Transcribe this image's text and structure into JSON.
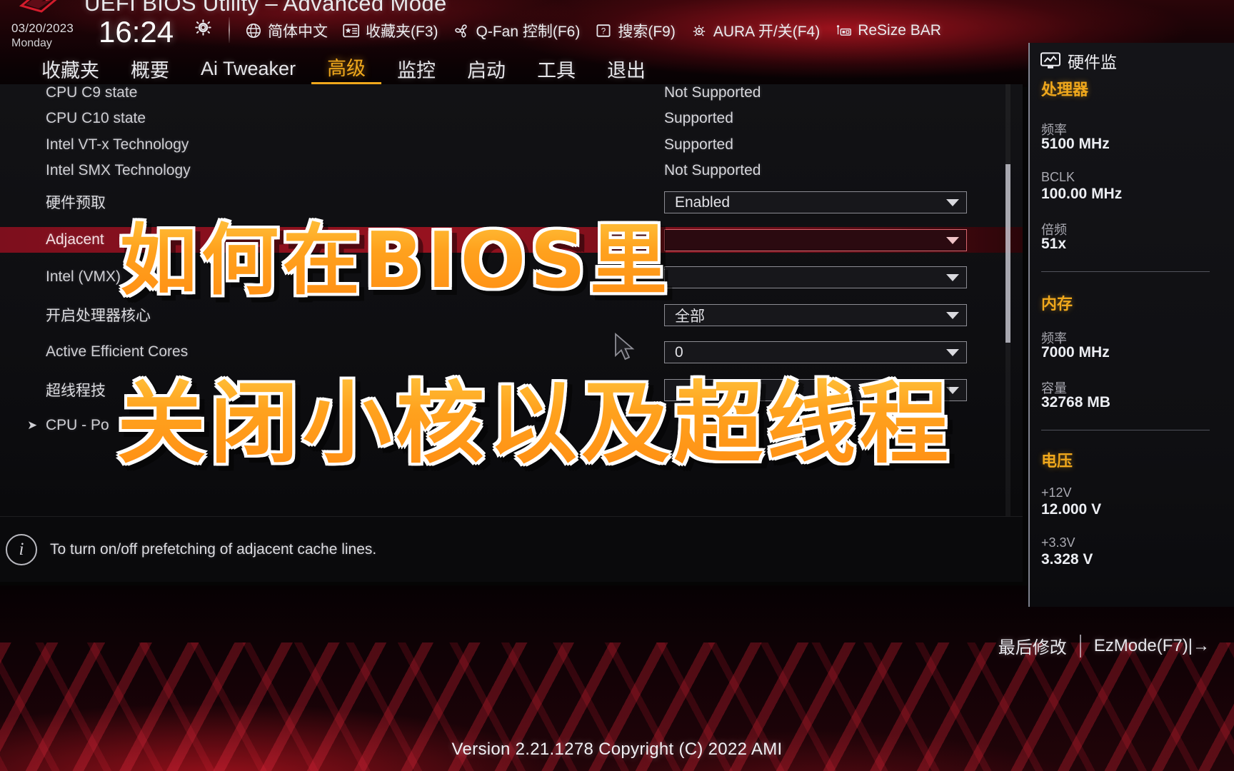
{
  "window": {
    "title": "UEFI BIOS Utility – Advanced Mode",
    "brand_logo": "rog-logo"
  },
  "statusbar": {
    "date": "03/20/2023",
    "weekday": "Monday",
    "time": "16:24",
    "settings_icon": "gear-icon",
    "tools": [
      {
        "icon": "globe-icon",
        "label": "简体中文"
      },
      {
        "icon": "star-icon",
        "label": "收藏夹(F3)"
      },
      {
        "icon": "fan-icon",
        "label": "Q-Fan 控制(F6)"
      },
      {
        "icon": "help-icon",
        "label": "搜索(F9)"
      },
      {
        "icon": "aura-icon",
        "label": "AURA 开/关(F4)"
      },
      {
        "icon": "resizebar-icon",
        "label": "ReSize BAR"
      }
    ]
  },
  "nav": {
    "tabs": [
      {
        "label": "收藏夹",
        "active": false
      },
      {
        "label": "概要",
        "active": false
      },
      {
        "label": "Ai Tweaker",
        "active": false
      },
      {
        "label": "高级",
        "active": true
      },
      {
        "label": "监控",
        "active": false
      },
      {
        "label": "启动",
        "active": false
      },
      {
        "label": "工具",
        "active": false
      },
      {
        "label": "退出",
        "active": false
      }
    ]
  },
  "settings": {
    "rows": [
      {
        "label": "CPU C9 state",
        "value": "Not Supported",
        "type": "text",
        "selected": false,
        "submenu": false
      },
      {
        "label": "CPU C10 state",
        "value": "Supported",
        "type": "text",
        "selected": false,
        "submenu": false
      },
      {
        "label": "Intel VT-x Technology",
        "value": "Supported",
        "type": "text",
        "selected": false,
        "submenu": false
      },
      {
        "label": "Intel SMX Technology",
        "value": "Not Supported",
        "type": "text",
        "selected": false,
        "submenu": false
      },
      {
        "label": "硬件预取",
        "value": "Enabled",
        "type": "combo",
        "selected": false,
        "submenu": false
      },
      {
        "label": "Adjacent",
        "value": "",
        "type": "combo",
        "selected": true,
        "submenu": false
      },
      {
        "label": "Intel (VMX)",
        "value": "",
        "type": "combo",
        "selected": false,
        "submenu": false
      },
      {
        "label": "开启处理器核心",
        "value": "全部",
        "type": "combo",
        "selected": false,
        "submenu": false
      },
      {
        "label": "Active Efficient Cores",
        "value": "0",
        "type": "combo",
        "selected": false,
        "submenu": false
      },
      {
        "label": "超线程技",
        "value": "",
        "type": "combo",
        "selected": false,
        "submenu": false
      },
      {
        "label": "CPU - Po",
        "value": "",
        "type": "submenu",
        "selected": false,
        "submenu": true
      }
    ]
  },
  "help": {
    "icon": "info-icon",
    "text": "To turn on/off prefetching of adjacent cache lines."
  },
  "hardware_monitor": {
    "icon": "monitor-icon",
    "title": "硬件监",
    "sections": [
      {
        "name": "处理器",
        "items": [
          {
            "key": "频率",
            "value": "5100 MHz"
          },
          {
            "key": "BCLK",
            "value": "100.00 MHz"
          },
          {
            "key": "倍频",
            "value": "51x"
          }
        ]
      },
      {
        "name": "内存",
        "items": [
          {
            "key": "频率",
            "value": "7000 MHz"
          },
          {
            "key": "容量",
            "value": "32768 MB"
          }
        ]
      },
      {
        "name": "电压",
        "items": [
          {
            "key": "+12V",
            "value": "12.000 V"
          },
          {
            "key": "+3.3V",
            "value": "3.328 V"
          }
        ]
      }
    ]
  },
  "footer": {
    "last_modified": "最后修改",
    "ez_mode": "EzMode(F7)|→",
    "version": "Version 2.21.1278 Copyright (C) 2022 AMI"
  },
  "overlay": {
    "caption_line1": "如何在BIOS里",
    "caption_line2": "关闭小核以及超线程"
  },
  "colors": {
    "accent_gold": "#f0a81c",
    "selection_red": "#96121f",
    "panel_bg": "#121215",
    "text_primary": "#e6e6ea",
    "caption_orange": "#ffa21e"
  }
}
